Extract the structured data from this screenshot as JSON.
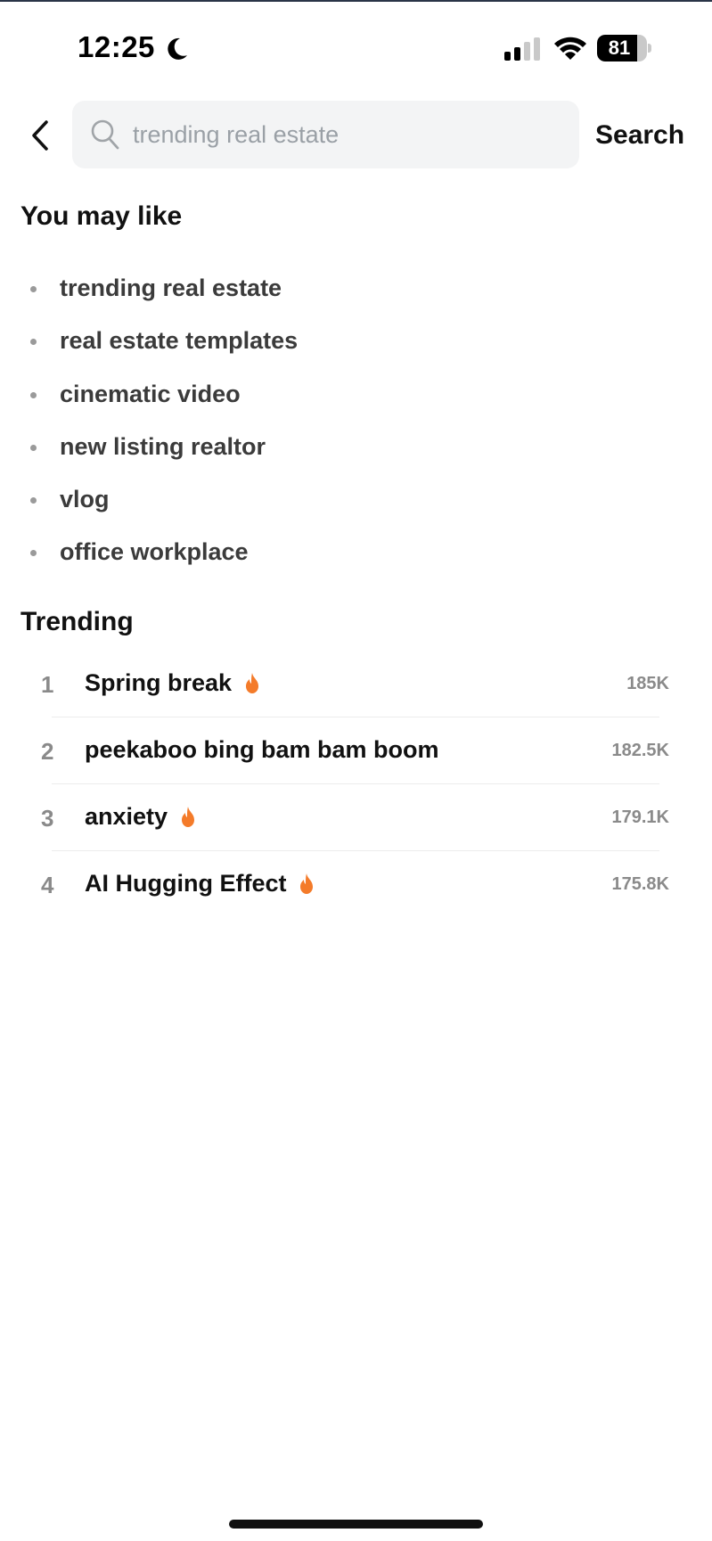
{
  "status_bar": {
    "time": "12:25",
    "battery_percent": "81",
    "battery_level": 0.81,
    "icons": [
      "moon-icon",
      "cellular-signal-icon",
      "wifi-icon",
      "battery-icon"
    ]
  },
  "search": {
    "back_icon": "chevron-left-icon",
    "search_icon": "magnifier-icon",
    "placeholder": "trending real estate",
    "value": "",
    "button_label": "Search"
  },
  "you_may_like": {
    "title": "You may like",
    "items": [
      {
        "label": "trending real estate"
      },
      {
        "label": "real estate templates"
      },
      {
        "label": "cinematic video"
      },
      {
        "label": "new listing realtor"
      },
      {
        "label": "vlog"
      },
      {
        "label": "office workplace"
      }
    ]
  },
  "trending": {
    "title": "Trending",
    "hot_icon": "fire-icon",
    "hot_color": "#f47b2a",
    "items": [
      {
        "rank": "1",
        "title": "Spring break",
        "hot": true,
        "count": "185K"
      },
      {
        "rank": "2",
        "title": "peekaboo bing bam bam boom",
        "hot": false,
        "count": "182.5K"
      },
      {
        "rank": "3",
        "title": "anxiety",
        "hot": true,
        "count": "179.1K"
      },
      {
        "rank": "4",
        "title": "AI Hugging Effect",
        "hot": true,
        "count": "175.8K"
      }
    ]
  }
}
